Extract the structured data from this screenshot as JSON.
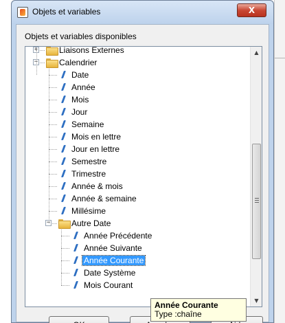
{
  "window": {
    "title": "Objets et variables",
    "close_label": "X"
  },
  "group_label": "Objets et variables disponibles",
  "tree": [
    {
      "label": "Liaisons Externes",
      "indent": 0,
      "kind": "folder",
      "expander": "+"
    },
    {
      "label": "Calendrier",
      "indent": 0,
      "kind": "folder-open",
      "expander": "−"
    },
    {
      "label": "Date",
      "indent": 1,
      "kind": "leaf"
    },
    {
      "label": "Année",
      "indent": 1,
      "kind": "leaf"
    },
    {
      "label": "Mois",
      "indent": 1,
      "kind": "leaf"
    },
    {
      "label": "Jour",
      "indent": 1,
      "kind": "leaf"
    },
    {
      "label": "Semaine",
      "indent": 1,
      "kind": "leaf"
    },
    {
      "label": "Mois en lettre",
      "indent": 1,
      "kind": "leaf"
    },
    {
      "label": "Jour en lettre",
      "indent": 1,
      "kind": "leaf"
    },
    {
      "label": "Semestre",
      "indent": 1,
      "kind": "leaf"
    },
    {
      "label": "Trimestre",
      "indent": 1,
      "kind": "leaf"
    },
    {
      "label": "Année & mois",
      "indent": 1,
      "kind": "leaf"
    },
    {
      "label": "Année & semaine",
      "indent": 1,
      "kind": "leaf"
    },
    {
      "label": "Millésime",
      "indent": 1,
      "kind": "leaf"
    },
    {
      "label": "Autre Date",
      "indent": 1,
      "kind": "folder-open",
      "expander": "−"
    },
    {
      "label": "Année Précédente",
      "indent": 2,
      "kind": "leaf"
    },
    {
      "label": "Année Suivante",
      "indent": 2,
      "kind": "leaf"
    },
    {
      "label": "Année Courante",
      "indent": 2,
      "kind": "leaf",
      "selected": true
    },
    {
      "label": "Date Système",
      "indent": 2,
      "kind": "leaf"
    },
    {
      "label": "Mois Courant",
      "indent": 2,
      "kind": "leaf"
    }
  ],
  "tooltip": {
    "title": "Année Courante",
    "type": "Type :chaîne"
  },
  "buttons": {
    "ok": "OK",
    "cancel": "Annuler",
    "help": "Aide"
  },
  "colors": {
    "selection": "#3399ff",
    "titlebar": "#bed3ec",
    "tooltip_bg": "#ffffe1"
  }
}
